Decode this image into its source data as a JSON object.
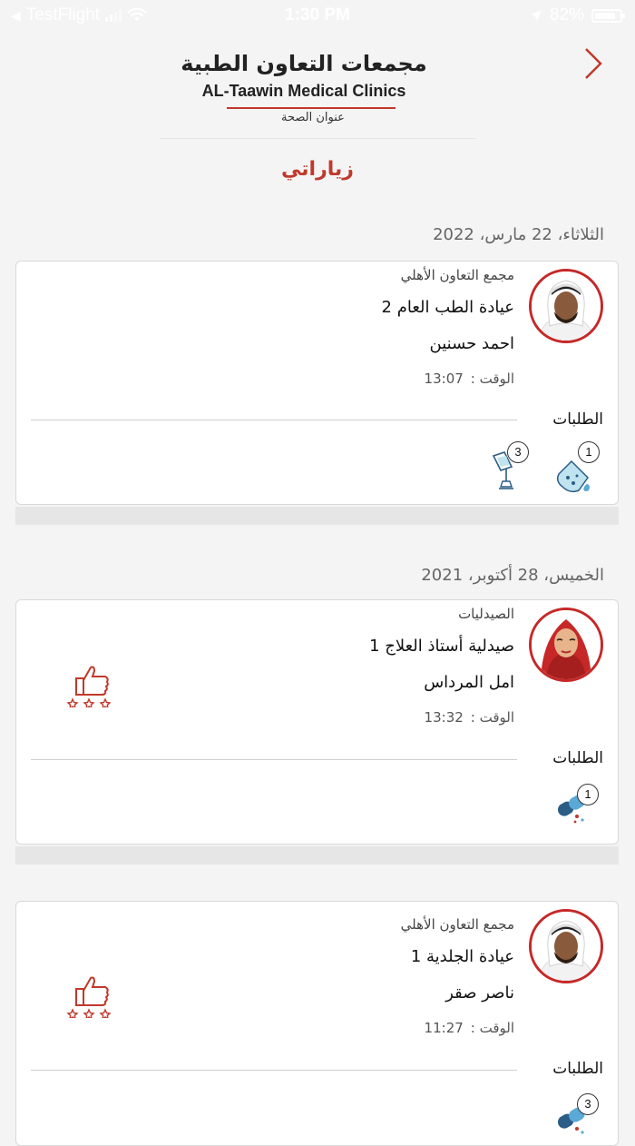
{
  "status_bar": {
    "carrier": "TestFlight",
    "time": "1:30 PM",
    "battery": "82%"
  },
  "header": {
    "logo_ar": "مجمعات التعاون الطبية",
    "logo_en": "AL-Taawin Medical Clinics",
    "logo_tagline": "عنوان الصحة"
  },
  "page_title": "زياراتي",
  "labels": {
    "time": "الوقت :",
    "orders": "الطلبات"
  },
  "visits": [
    {
      "date": "الثلاثاء، 22 مارس، 2022",
      "facility": "مجمع التعاون الأهلي",
      "clinic": "عيادة الطب العام 2",
      "doctor": "احمد حسنين",
      "time": "13:07",
      "avatar": "male-doctor",
      "orders": [
        {
          "icon": "lab-flask-icon",
          "count": "1"
        },
        {
          "icon": "radiology-microscope-icon",
          "count": "3"
        }
      ]
    },
    {
      "date": "الخميس، 28 أكتوبر، 2021",
      "facility": "الصيدليات",
      "clinic": "صيدلية أستاذ العلاج 1",
      "doctor": "امل المرداس",
      "time": "13:32",
      "avatar": "female-doctor",
      "rating_icon": "thumbs-up-stars-icon",
      "orders": [
        {
          "icon": "medicine-capsule-icon",
          "count": "1"
        }
      ]
    },
    {
      "date": "",
      "facility": "مجمع التعاون الأهلي",
      "clinic": "عيادة الجلدية 1",
      "doctor": "ناصر صقر",
      "time": "11:27",
      "avatar": "male-doctor",
      "rating_icon": "thumbs-up-stars-icon",
      "orders": [
        {
          "icon": "medicine-capsule-icon",
          "count": "3"
        }
      ]
    }
  ],
  "colors": {
    "accent": "#c0392b",
    "avatar_ring": "#c62828",
    "background": "#f4f4f4"
  }
}
